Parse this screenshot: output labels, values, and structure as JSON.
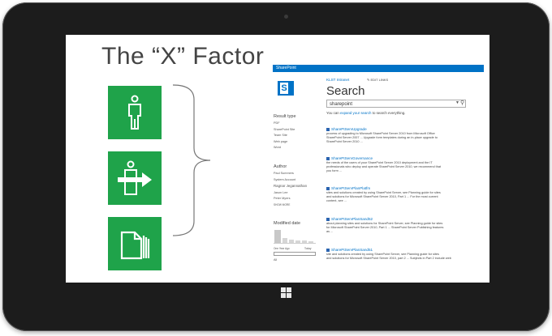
{
  "slide_title": "The “X” Factor",
  "tiles": [
    {
      "icon": "person-icon"
    },
    {
      "icon": "person-with-arrow-icon"
    },
    {
      "icon": "documents-icon"
    }
  ],
  "sharepoint": {
    "top_bar": "SharePoint",
    "logo_letter": "S",
    "breadcrumb": "KLST Intranet",
    "edit_links": "EDIT LINKS",
    "page_heading": "Search",
    "search_value": "sharepoint",
    "hint_prefix": "You can ",
    "hint_link": "expand your search",
    "hint_suffix": " to search everything.",
    "refiners": {
      "result_type_heading": "Result type",
      "result_types": [
        "PDF",
        "SharePoint Site",
        "Team Site",
        "Web page",
        "Word"
      ],
      "author_heading": "Author",
      "authors": [
        "Paul Summers",
        "System Account",
        "Ragnar Jegannathan",
        "Jason Lee",
        "Peter Myers"
      ],
      "show_more": "SHOW MORE",
      "modified_heading": "Modified date",
      "date_from": "One Year Ago",
      "date_to": "Today",
      "date_all": "All"
    },
    "results": [
      {
        "title": "SharePtServUpgrade",
        "lines": [
          "process of upgrading to Microsoft SharePoint Server 2010 from Microsoft Office",
          "SharePoint Server 2007 ... Upgrade form templates during an in-place upgrade to",
          "SharePoint Server 2010 ..."
        ]
      },
      {
        "title": "SharePtServGovernance",
        "lines": [
          "the needs of the users of your SharePoint Server 2010 deployment and the IT",
          "professionals who deploy and operate SharePoint Server 2010, we recommend that",
          "you form ..."
        ]
      },
      {
        "title": "SharePtServPlanPlatfm",
        "lines": [
          "sites and solutions created by using SharePoint Server, see Planning guide for sites",
          "and solutions for Microsoft SharePoint Server 2010, Part 1 ... For the most current",
          "content, see ..."
        ]
      },
      {
        "title": "SharePtServPlanSand52",
        "lines": [
          "about planning sites and solutions for SharePoint Server, see Planning guide for sites",
          "for Microsoft SharePoint Server 2010, Part 1 ... SharePoint Server Publishing features",
          "as ..."
        ]
      },
      {
        "title": "SharePtServPlanSand51",
        "lines": [
          "site and solutions created by using SharePoint Server, see Planning guide for sites",
          "and solutions for Microsoft SharePoint Server 2010, part 2 ... Subjects in Part 2 include web"
        ]
      }
    ]
  }
}
